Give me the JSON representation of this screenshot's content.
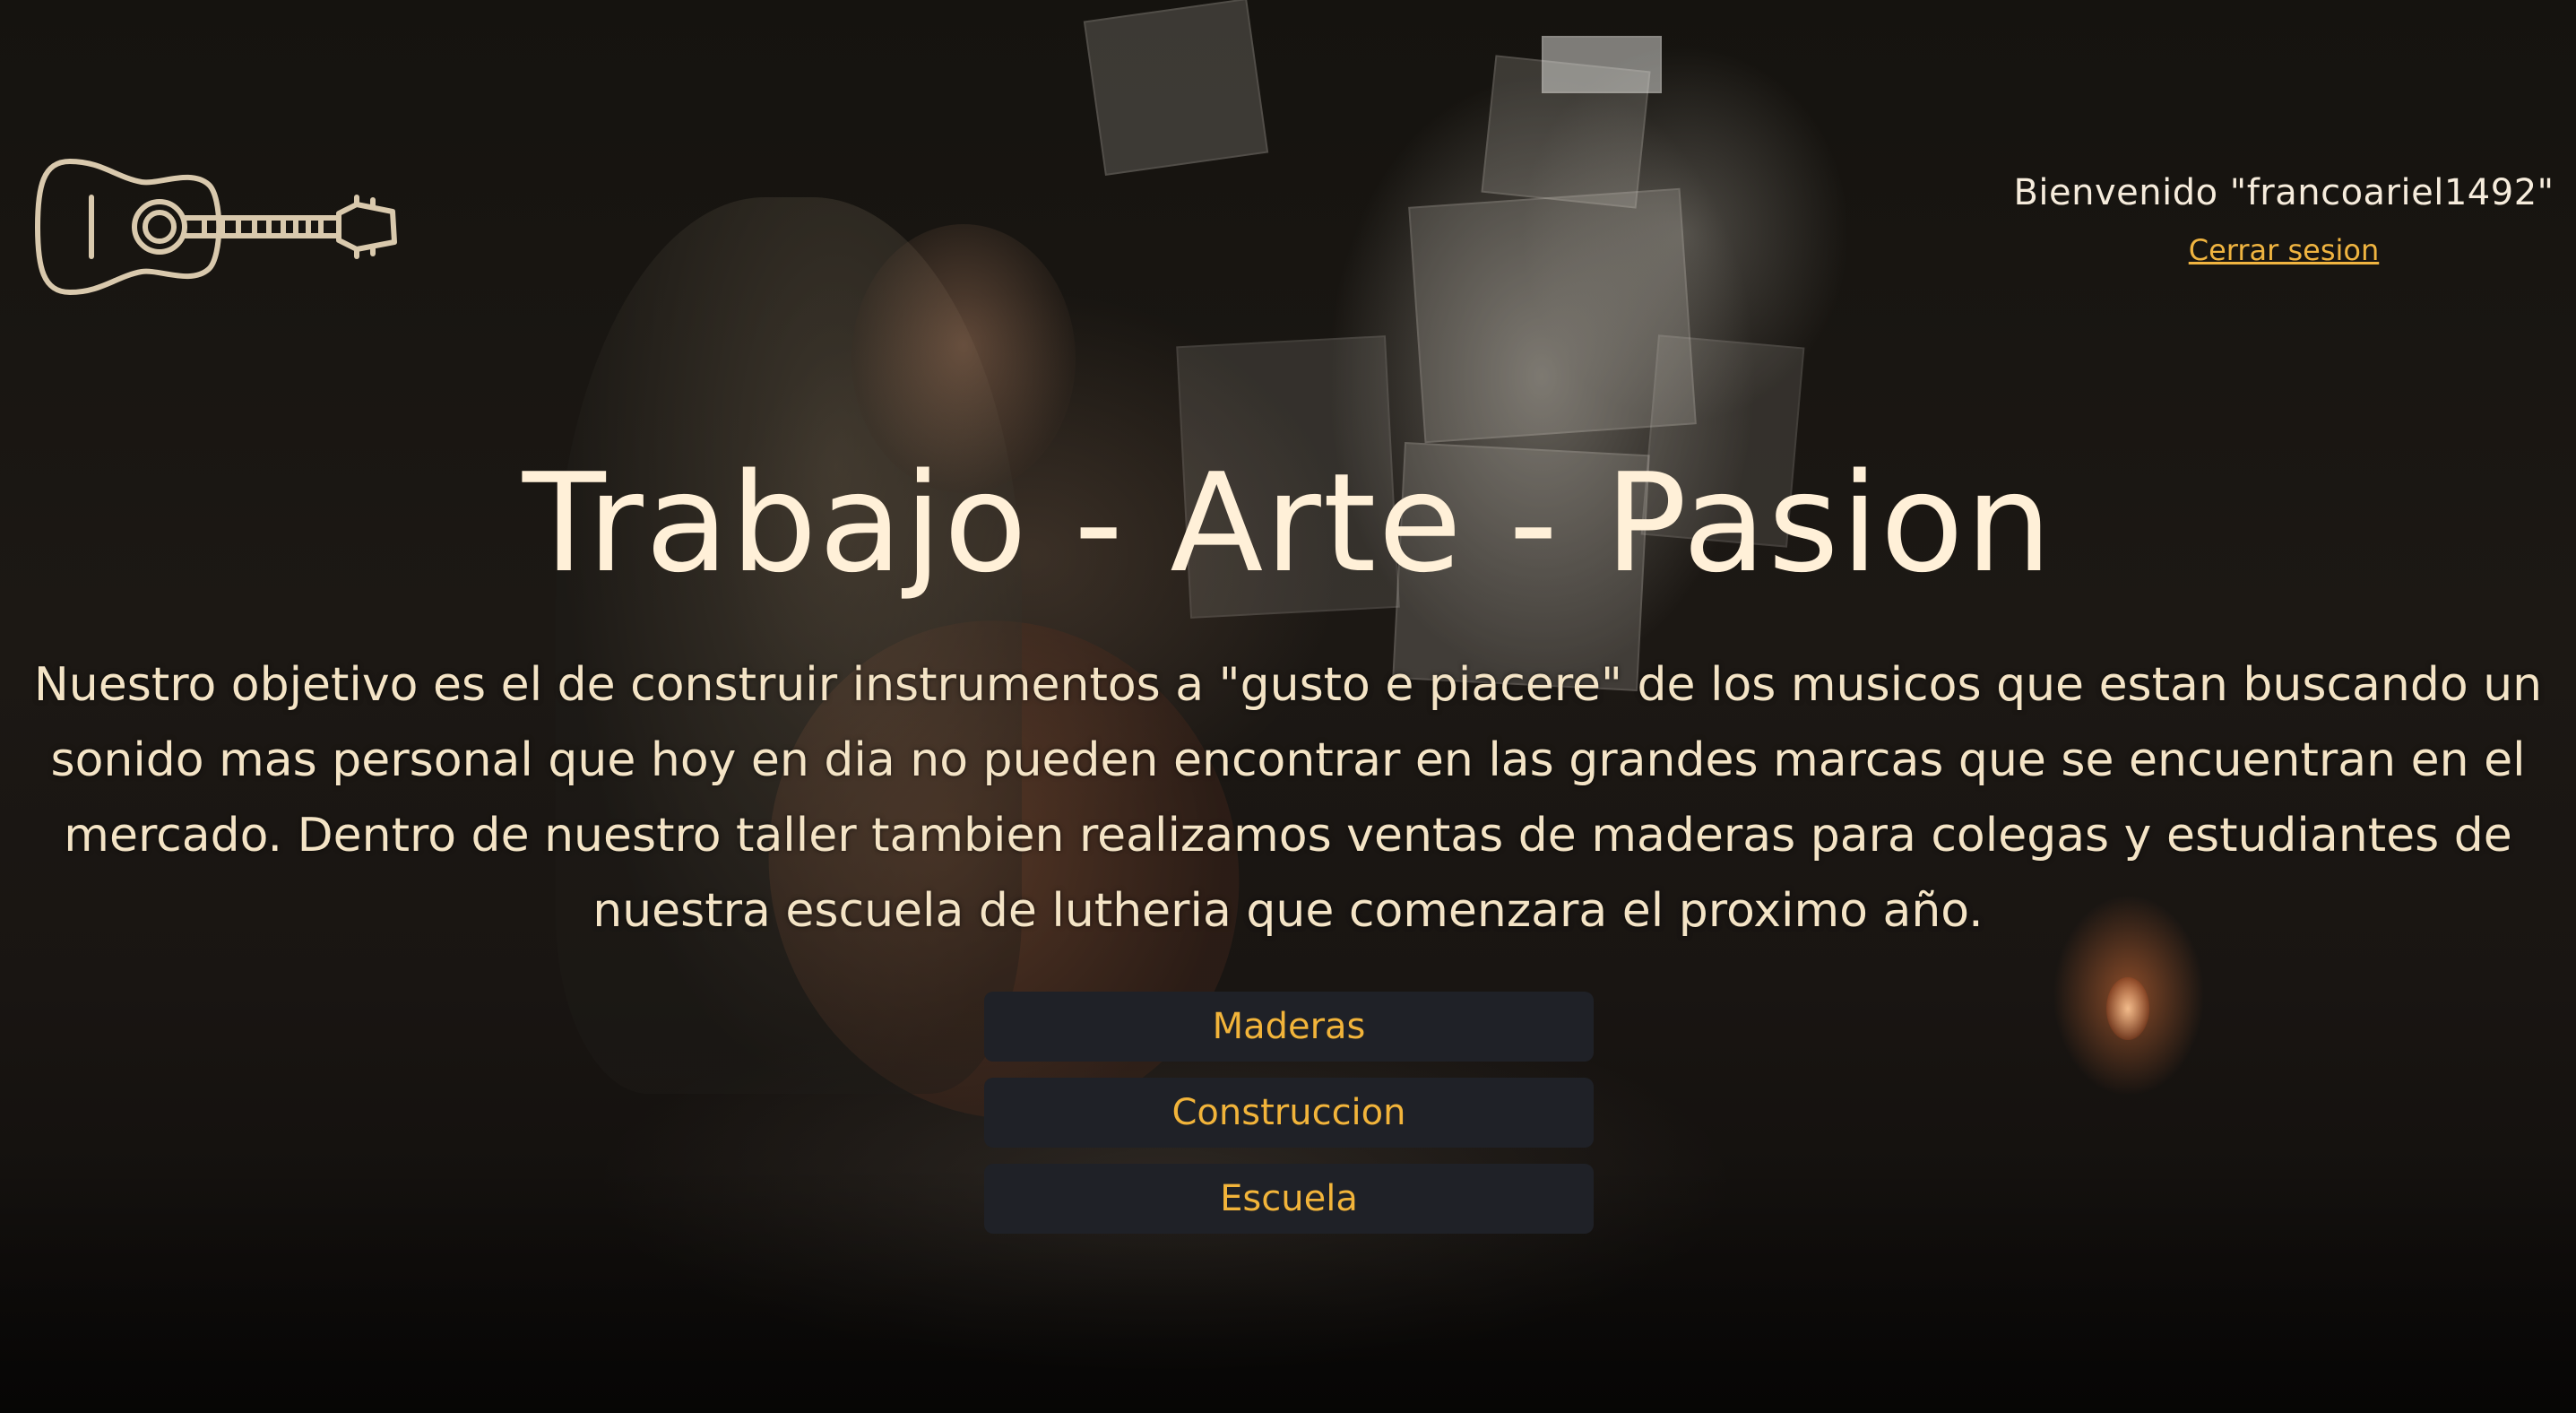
{
  "header": {
    "logo_icon": "guitar-icon",
    "welcome_text": "Bienvenido \"francoariel1492\"",
    "logout_label": "Cerrar sesion"
  },
  "hero": {
    "title": "Trabajo - Arte - Pasion",
    "description": "Nuestro objetivo es el de construir instrumentos a \"gusto e piacere\" de los musicos que estan buscando un sonido mas personal que hoy en dia no pueden encontrar en las grandes marcas que se encuentran en el mercado. Dentro de nuestro taller tambien realizamos ventas de maderas para colegas y estudiantes de nuestra escuela de lutheria que comenzara el proximo año."
  },
  "nav": {
    "items": [
      {
        "label": "Maderas"
      },
      {
        "label": "Construccion"
      },
      {
        "label": "Escuela"
      }
    ]
  },
  "colors": {
    "accent": "#f2b43a",
    "title": "#fff0d8",
    "button_bg": "#1f2127",
    "logo_stroke": "#d9c9ad"
  }
}
